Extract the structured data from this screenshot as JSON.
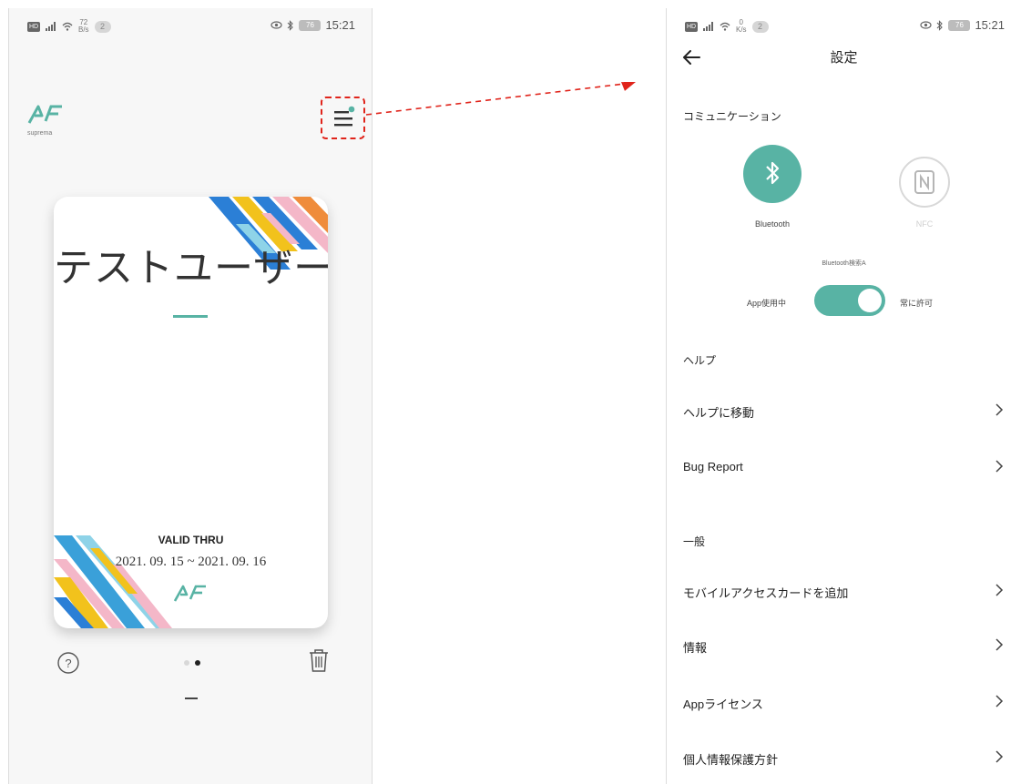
{
  "status_bar": {
    "left_screen": {
      "speed": "72\nB/s",
      "badge": "2",
      "battery": "76",
      "time": "15:21"
    },
    "right_screen": {
      "speed": "0\nK/s",
      "badge": "2",
      "battery": "76",
      "time": "15:21"
    }
  },
  "home": {
    "brand": "suprema",
    "card": {
      "name": "テストユーザー",
      "valid_label": "VALID THRU",
      "valid_dates": "2021. 09. 15 ~ 2021. 09. 16"
    },
    "page_index": 2,
    "page_count": 2
  },
  "settings": {
    "title": "設定",
    "communication": {
      "header": "コミュニケーション",
      "bluetooth_label": "Bluetooth",
      "nfc_label": "NFC",
      "scan_label": "Bluetooth検索A",
      "toggle_left": "App使用中",
      "toggle_right": "常に許可",
      "toggle_on": true
    },
    "help": {
      "header": "ヘルプ",
      "items": [
        {
          "label": "ヘルプに移動"
        },
        {
          "label": "Bug Report"
        }
      ]
    },
    "general": {
      "header": "一般",
      "items": [
        {
          "label": "モバイルアクセスカードを追加"
        },
        {
          "label": "情報"
        },
        {
          "label": "Appライセンス"
        },
        {
          "label": "個人情報保護方針"
        }
      ]
    }
  },
  "colors": {
    "accent": "#58b3a4",
    "highlight": "#e0241b",
    "nfc_inactive": "#c8c8c8"
  },
  "icons": [
    "menu-icon",
    "help-icon",
    "trash-icon",
    "back-arrow-icon",
    "bluetooth-icon",
    "nfc-icon",
    "chevron-right-icon"
  ]
}
